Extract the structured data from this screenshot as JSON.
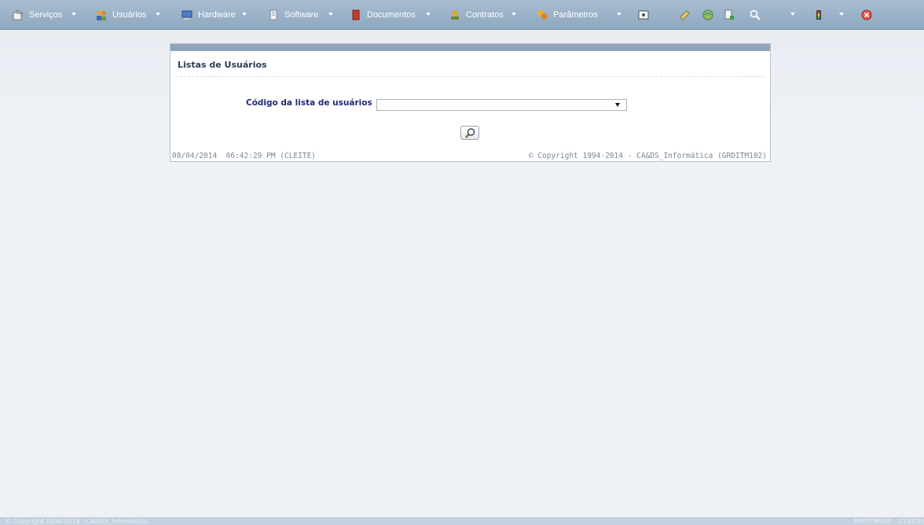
{
  "menu": {
    "items": [
      {
        "label": "Serviços",
        "icon": "services-icon",
        "color": "#e2e2e2"
      },
      {
        "label": "Usuários",
        "icon": "users-icon",
        "color": "#c8a04a"
      },
      {
        "label": "Hardware",
        "icon": "hardware-icon",
        "color": "#5b8bd0"
      },
      {
        "label": "Software",
        "icon": "software-icon",
        "color": "#d7dde4"
      },
      {
        "label": "Documentos",
        "icon": "documents-icon",
        "color": "#c43a2a"
      },
      {
        "label": "Contratos",
        "icon": "contracts-icon",
        "color": "#c9a23a"
      },
      {
        "label": "Parâmetros",
        "icon": "parameters-icon",
        "color": "#e6b03a"
      }
    ],
    "tools": [
      "window-icon",
      "notepad-icon",
      "globe-icon",
      "add-document-icon",
      "search-icon",
      "traffic-light-icon",
      "close-icon"
    ]
  },
  "panel": {
    "title": "Listas de Usuários",
    "field_label": "Código da lista de usuários",
    "select_value": "",
    "footer_left": "08/04/2014  06:42:29 PM (CLEITE)",
    "footer_right": "© Copyright 1994-2014 - CA&DS_Informática (GRDITM102)"
  },
  "statusbar": {
    "left": "© Copyright 1994-2014 - CA&DS_Informática",
    "right": "MNTITM000 - (CLEITE)"
  },
  "colors": {
    "menubar": "#9cb3ca",
    "panel_header": "#8fa5bb",
    "label": "#1f2a7a"
  }
}
